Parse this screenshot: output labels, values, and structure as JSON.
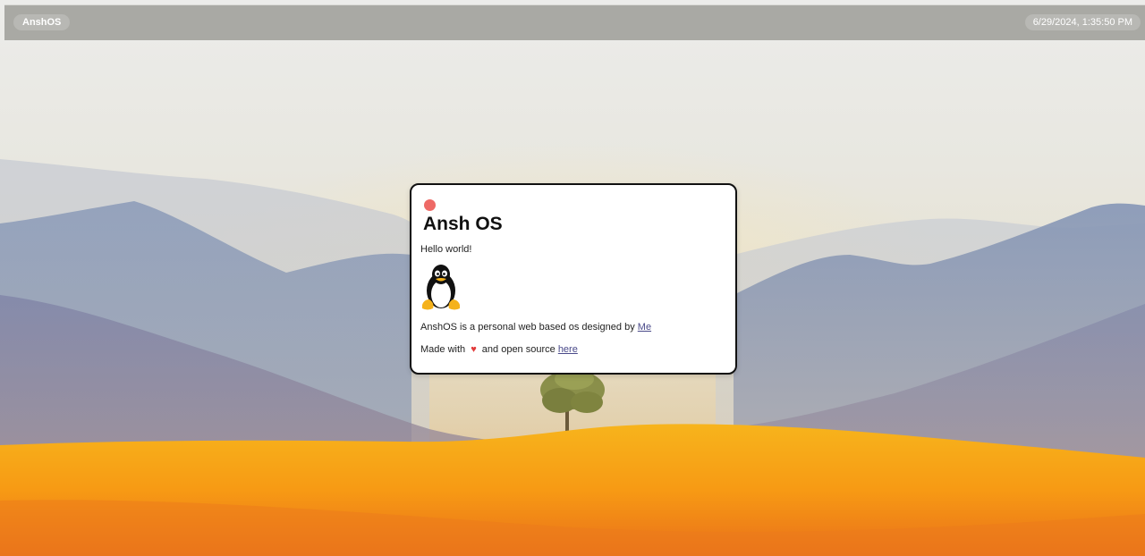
{
  "topbar": {
    "brand": "AnshOS",
    "datetime": "6/29/2024, 1:35:50 PM"
  },
  "window": {
    "title": "Ansh OS",
    "greeting": "Hello world!",
    "description_prefix": "AnshOS is a personal web based os designed by",
    "designer_link": "Me",
    "made_with_prefix": "Made with",
    "heart": "♥",
    "made_with_suffix": "and open source",
    "source_link": "here"
  },
  "colors": {
    "close_button": "#ee6a66",
    "topbar": "#96968f",
    "link": "#4a4a8a"
  },
  "icons": {
    "mascot": "tux-penguin-icon",
    "heart": "heart-icon"
  }
}
